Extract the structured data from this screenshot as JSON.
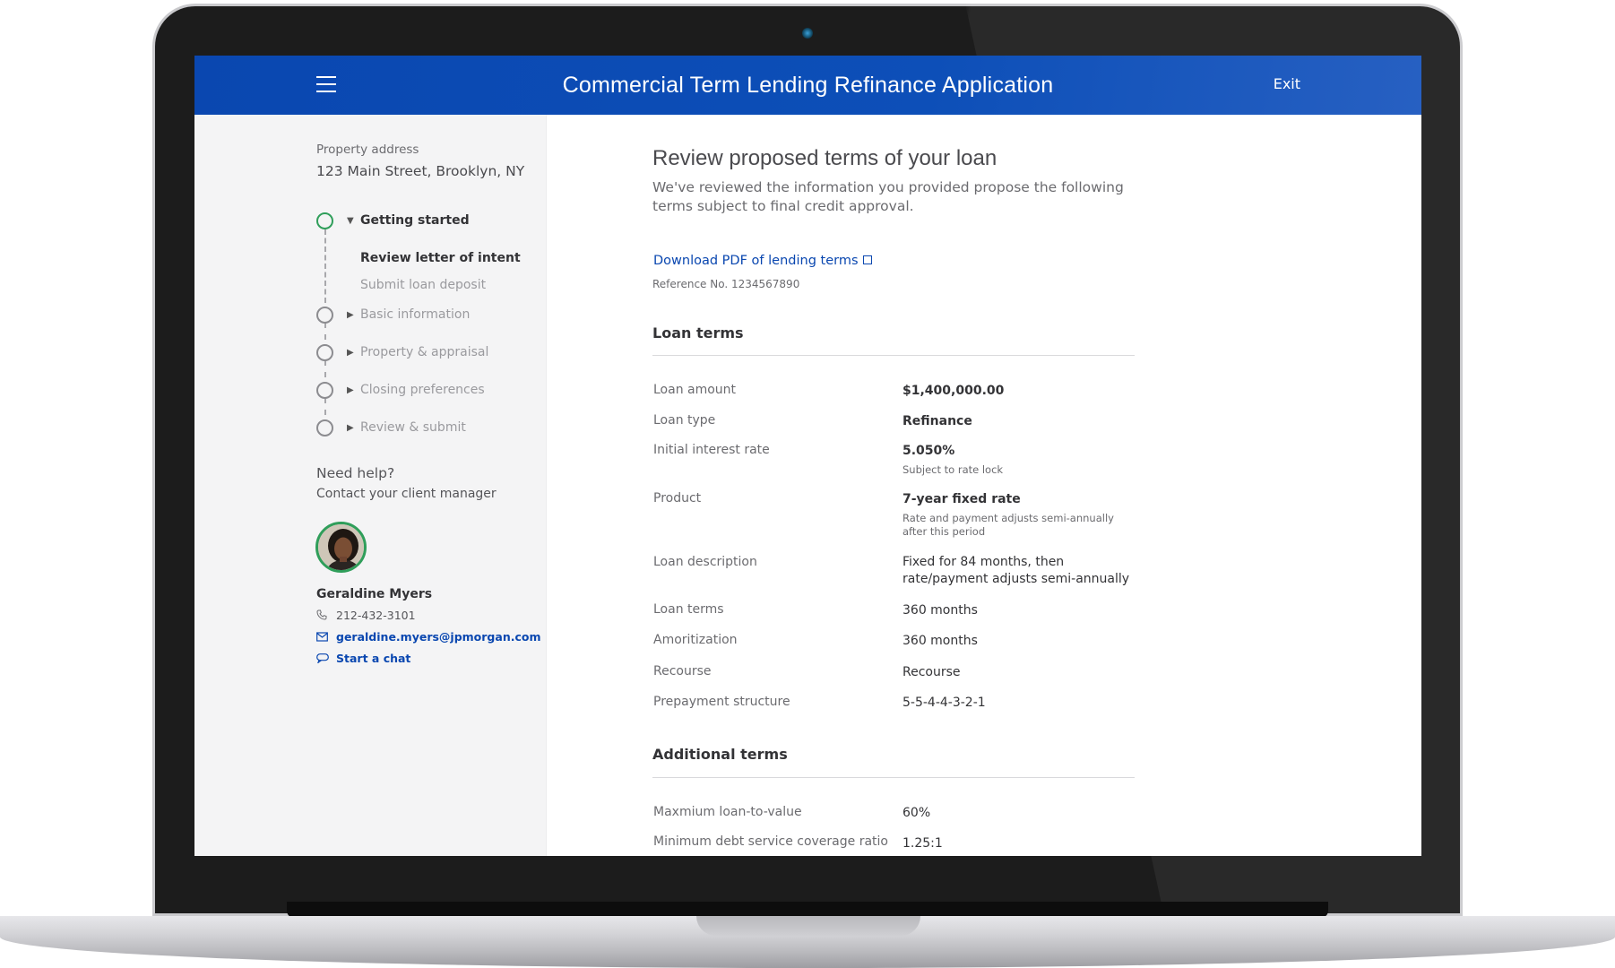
{
  "header": {
    "title": "Commercial Term Lending Refinance Application",
    "exit_label": "Exit"
  },
  "sidebar": {
    "property_label": "Property address",
    "property_value": "123 Main Street, Brooklyn, NY",
    "steps": [
      {
        "label": "Getting started",
        "state": "active",
        "caret": "▼"
      },
      {
        "label": "Basic information",
        "state": "pending",
        "caret": "▶"
      },
      {
        "label": "Property & appraisal",
        "state": "pending",
        "caret": "▶"
      },
      {
        "label": "Closing preferences",
        "state": "pending",
        "caret": "▶"
      },
      {
        "label": "Review & submit",
        "state": "pending",
        "caret": "▶"
      }
    ],
    "sub_steps": [
      {
        "label": "Review letter of intent",
        "state": "current"
      },
      {
        "label": "Submit loan deposit",
        "state": "pending"
      }
    ],
    "help": {
      "title": "Need help?",
      "subtitle": "Contact your client manager",
      "manager_name": "Geraldine Myers",
      "phone": "212-432-3101",
      "email": "geraldine.myers@jpmorgan.com",
      "chat_label": "Start a chat"
    }
  },
  "main": {
    "title": "Review proposed terms of your loan",
    "description": "We've reviewed the information you provided propose the following terms subject to final credit approval.",
    "download_label": "Download PDF of lending terms",
    "reference": "Reference No. 1234567890",
    "loan_terms": {
      "title": "Loan terms",
      "rows": [
        {
          "label": "Loan amount",
          "value": "$1,400,000.00",
          "note": ""
        },
        {
          "label": "Loan type",
          "value": "Refinance",
          "note": ""
        },
        {
          "label": "Initial interest rate",
          "value": "5.050%",
          "note": "Subject to rate lock"
        },
        {
          "label": "Product",
          "value": "7-year fixed rate",
          "note": "Rate and payment adjusts semi-annually after this period"
        },
        {
          "label": "Loan description",
          "value": "Fixed for 84 months, then rate/payment adjusts semi-annually",
          "note": ""
        },
        {
          "label": "Loan terms",
          "value": "360 months",
          "note": ""
        },
        {
          "label": "Amoritization",
          "value": "360 months",
          "note": ""
        },
        {
          "label": "Recourse",
          "value": "Recourse",
          "note": ""
        },
        {
          "label": "Prepayment structure",
          "value": "5-5-4-4-3-2-1",
          "note": ""
        }
      ]
    },
    "additional_terms": {
      "title": "Additional terms",
      "rows": [
        {
          "label": "Maxmium loan-to-value",
          "value": "60%"
        },
        {
          "label": "Minimum debt service coverage ratio",
          "value": "1.25:1"
        }
      ]
    }
  },
  "colors": {
    "header_blue": "#0d4fb8",
    "active_green": "#2f9e5a",
    "link_blue": "#0a47b0",
    "sidebar_bg": "#f4f4f5"
  }
}
